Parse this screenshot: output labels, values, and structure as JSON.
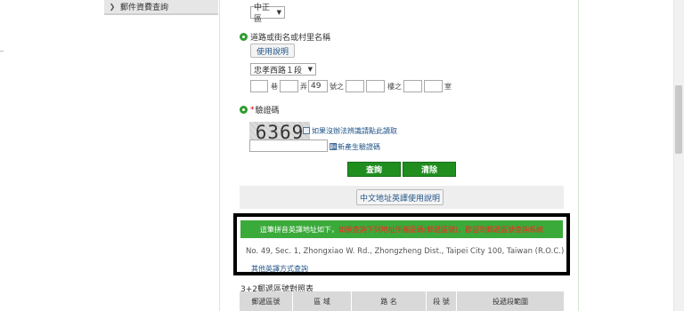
{
  "sidebar": {
    "item_label": "郵件資費查詢"
  },
  "district": {
    "selected": "中正區"
  },
  "road_section": {
    "title": "道路或街名或村里名稱",
    "help_button": "使用說明",
    "road_selected": "忠孝西路１段",
    "units": {
      "lane": "巷",
      "alley": "弄",
      "number_of": "號之",
      "floor_of": "樓之",
      "room": "室"
    },
    "number_value": "49"
  },
  "captcha_section": {
    "title": "驗證碼",
    "captcha_text": "6369",
    "unclear_link": "如果沒辦法辨識請點此讀取",
    "refresh_link": "重新產生驗證碼",
    "input_value": ""
  },
  "actions": {
    "search": "查詢",
    "clear": "清除"
  },
  "guide_button": "中文地址英譯使用說明",
  "result": {
    "banner_prefix": "這筆拼音英譯地址如下，",
    "banner_warning": "如欲查詢下列地址所屬區碼(郵遞區號)，歡迎到郵遞區號查詢系統",
    "address": "No. 49, Sec. 1, Zhongxiao W. Rd., Zhongzheng Dist., Taipei City 100, Taiwan (R.O.C.)",
    "other_link": "其他英譯方式查詢"
  },
  "table": {
    "title": "3+2郵遞區號對照表",
    "headers": [
      "郵遞區號",
      "區 域",
      "路 名",
      "段 號",
      "投遞段範圍"
    ]
  }
}
